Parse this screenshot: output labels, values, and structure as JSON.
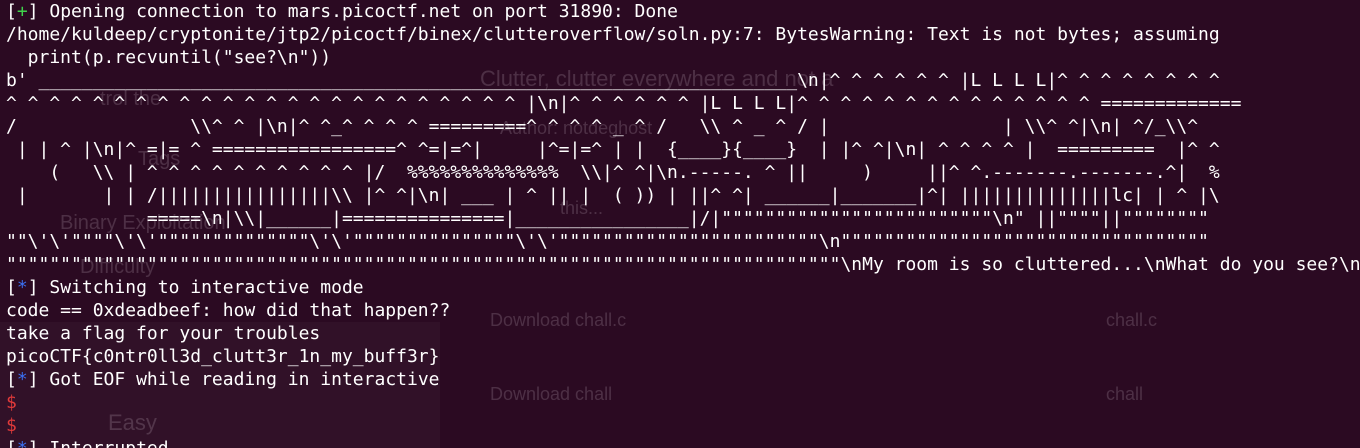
{
  "terminal": {
    "lines": [
      {
        "kind": "status",
        "mark": "+",
        "text": " Opening connection to mars.picoctf.net on port 31890: Done"
      },
      {
        "kind": "plain",
        "text": "/home/kuldeep/cryptonite/jtp2/picoctf/binex/clutteroverflow/soln.py:7: BytesWarning: Text is not bytes; assuming"
      },
      {
        "kind": "plain",
        "text": "  print(p.recvuntil(\"see?\\n\"))"
      },
      {
        "kind": "plain",
        "text": "b' ______________________________________________________________________\\n|^ ^ ^ ^ ^ ^ |L L L L|^ ^ ^ ^ ^ ^ ^ ^"
      },
      {
        "kind": "plain",
        "text": "^ ^ ^ ^ ^ ^ ^ ^ ^ ^ ^ ^ ^ ^ ^ ^ ^ ^ ^ ^ ^ ^ ^ ^ |\\n|^ ^ ^ ^ ^ ^ |L L L L|^ ^ ^ ^ ^ ^ ^ ^ ^ ^ ^ ^ ^ ^ ============="
      },
      {
        "kind": "plain",
        "text": "/                \\\\^ ^ |\\n|^ ^_^ ^ ^ ^ =========^ ^ ^ ^ _ ^ /   \\\\ ^ _ ^ / |                | \\\\^ ^|\\n| ^/_\\\\^"
      },
      {
        "kind": "plain",
        "text": " | | ^ |\\n|^ =|= ^ =================^ ^=|=^|     |^=|=^ | |  {____}{____}  | |^ ^|\\n| ^ ^ ^ ^ |  =========  |^ ^"
      },
      {
        "kind": "plain",
        "text": "    (   \\\\ | ^ ^ ^ ^ ^ ^ ^ ^ ^ ^ |/  %%%%%%%%%%%%%%  \\\\|^ ^|\\n.-----. ^ ||     )     ||^ ^.-------.-------.^|  %"
      },
      {
        "kind": "plain",
        "text": " |       | | /||||||||||||||||\\\\ |^ ^|\\n| ___ | ^ || |  ( )) | ||^ ^| ______|_______|^| ||||||||||||||lc| | ^ |\\"
      },
      {
        "kind": "plain",
        "text": "             =====\\n|\\\\|______|===============|________________|/|\"\"\"\"\"\"\"\"\"\"\"\"\"\"\"\"\"\"\"\"\"\"\"\"\"\\n\" ||\"\"\"\"||\"\"\"\"\"\"\"\""
      },
      {
        "kind": "plain",
        "text": "\"\"\\'\\'\"\"\"\"\\'\\'\"\"\"\"\"\"\"\"\"\"\"\"\"\"\\'\\'\"\"\"\"\"\"\"\"\"\"\"\"\"\"\"\\'\\'\"\"\"\"\"\"\"\"\"\"\"\"\"\"\"\"\"\"\"\"\"\"\"\"\\n\"\"\"\"\"\"\"\"\"\"\"\"\"\"\"\"\"\"\"\"\"\"\"\"\"\"\"\"\"\"\"\"\"\""
      },
      {
        "kind": "plain",
        "text": "\"\"\"\"\"\"\"\"\"\"\"\"\"\"\"\"\"\"\"\"\"\"\"\"\"\"\"\"\"\"\"\"\"\"\"\"\"\"\"\"\"\"\"\"\"\"\"\"\"\"\"\"\"\"\"\"\"\"\"\"\"\"\"\"\"\"\"\"\"\"\"\"\"\"\"\"\"\\nMy room is so cluttered...\\nWhat do you see?\\n'"
      },
      {
        "kind": "status",
        "mark": "*",
        "text": " Switching to interactive mode"
      },
      {
        "kind": "plain",
        "text": "code == 0xdeadbeef: how did that happen??"
      },
      {
        "kind": "plain",
        "text": "take a flag for your troubles"
      },
      {
        "kind": "plain",
        "text": "picoCTF{c0ntr0ll3d_clutt3r_1n_my_buff3r}"
      },
      {
        "kind": "status",
        "mark": "*",
        "text": " Got EOF while reading in interactive"
      },
      {
        "kind": "prompt",
        "text": "$"
      },
      {
        "kind": "prompt",
        "text": "$"
      },
      {
        "kind": "status",
        "mark": "*",
        "text": " Interrupted"
      }
    ]
  },
  "background_page": {
    "heading": "Clutter, clutter everywhere and not a",
    "author": "Author: notdeghost",
    "description_fragment": "trol the",
    "description_fragment2": "this...",
    "file1_link": "Download chall.c",
    "file1_name": "chall.c",
    "file2_link": "Download chall",
    "file2_name": "chall",
    "label_tags": "Tags",
    "label_category": "Binary Exploitation",
    "label_difficulty": "Difficulty",
    "label_easy": "Easy"
  },
  "colors": {
    "background": "#2b0a22",
    "text": "#ffffff",
    "plus": "#3fd24b",
    "star": "#3b6ff0",
    "prompt": "#e03a3a"
  }
}
